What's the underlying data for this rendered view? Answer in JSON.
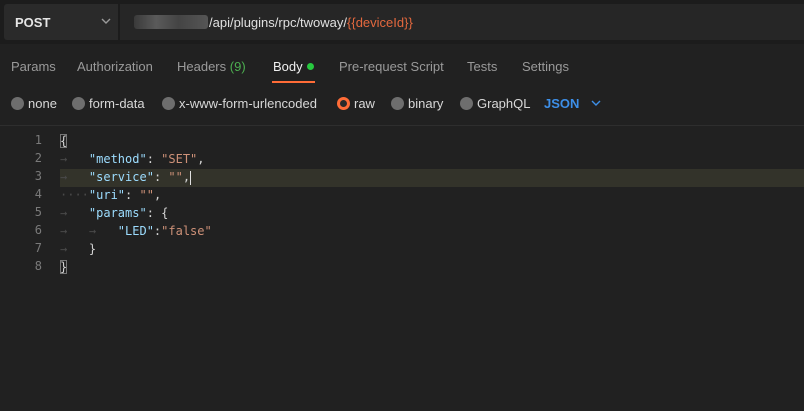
{
  "request": {
    "method": "POST",
    "url_path": "/api/plugins/rpc/twoway/",
    "url_variable": "{{deviceId}}"
  },
  "tabs": [
    {
      "label": "Params"
    },
    {
      "label": "Authorization"
    },
    {
      "label": "Headers",
      "count": "(9)"
    },
    {
      "label": "Body"
    },
    {
      "label": "Pre-request Script"
    },
    {
      "label": "Tests"
    },
    {
      "label": "Settings"
    }
  ],
  "active_tab": "Body",
  "body_types": [
    {
      "label": "none"
    },
    {
      "label": "form-data"
    },
    {
      "label": "x-www-form-urlencoded"
    },
    {
      "label": "raw"
    },
    {
      "label": "binary"
    },
    {
      "label": "GraphQL"
    }
  ],
  "selected_body_type": "raw",
  "raw_language": "JSON",
  "editor": {
    "line_numbers": [
      "1",
      "2",
      "3",
      "4",
      "5",
      "6",
      "7",
      "8"
    ],
    "tokens": {
      "open_brace": "{",
      "method_key": "\"method\"",
      "method_value": "\"SET\"",
      "service_key": "\"service\"",
      "service_value": "\"\"",
      "uri_key": "\"uri\"",
      "uri_value": "\"\"",
      "params_key": "\"params\"",
      "params_open": "{",
      "led_key": "\"LED\"",
      "led_value": "\"false\"",
      "params_close": "}",
      "close_brace": "}"
    }
  },
  "colors": {
    "accent": "#ff6c37",
    "json_link": "#3d8fe8",
    "url_variable": "#e3683e",
    "status_dot": "#27c93f"
  }
}
